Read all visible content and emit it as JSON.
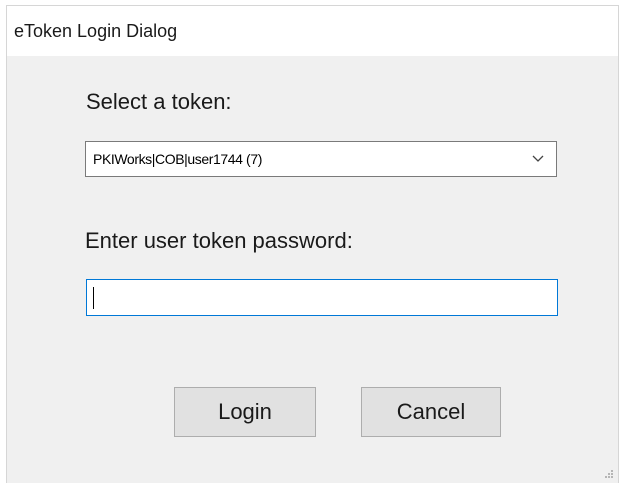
{
  "window": {
    "title": "eToken Login Dialog"
  },
  "form": {
    "select_label": "Select a token:",
    "selected_token": "PKIWorks|COB|user1744 (7)",
    "password_label": "Enter user token password:",
    "password_value": ""
  },
  "buttons": {
    "login_label": "Login",
    "cancel_label": "Cancel"
  },
  "icons": {
    "combo_arrow": "chevron-down-icon",
    "resize_grip": "resize-grip-icon"
  },
  "colors": {
    "focus_border": "#0078d7",
    "client_background": "#f0f0f0",
    "button_face": "#e1e1e1"
  }
}
